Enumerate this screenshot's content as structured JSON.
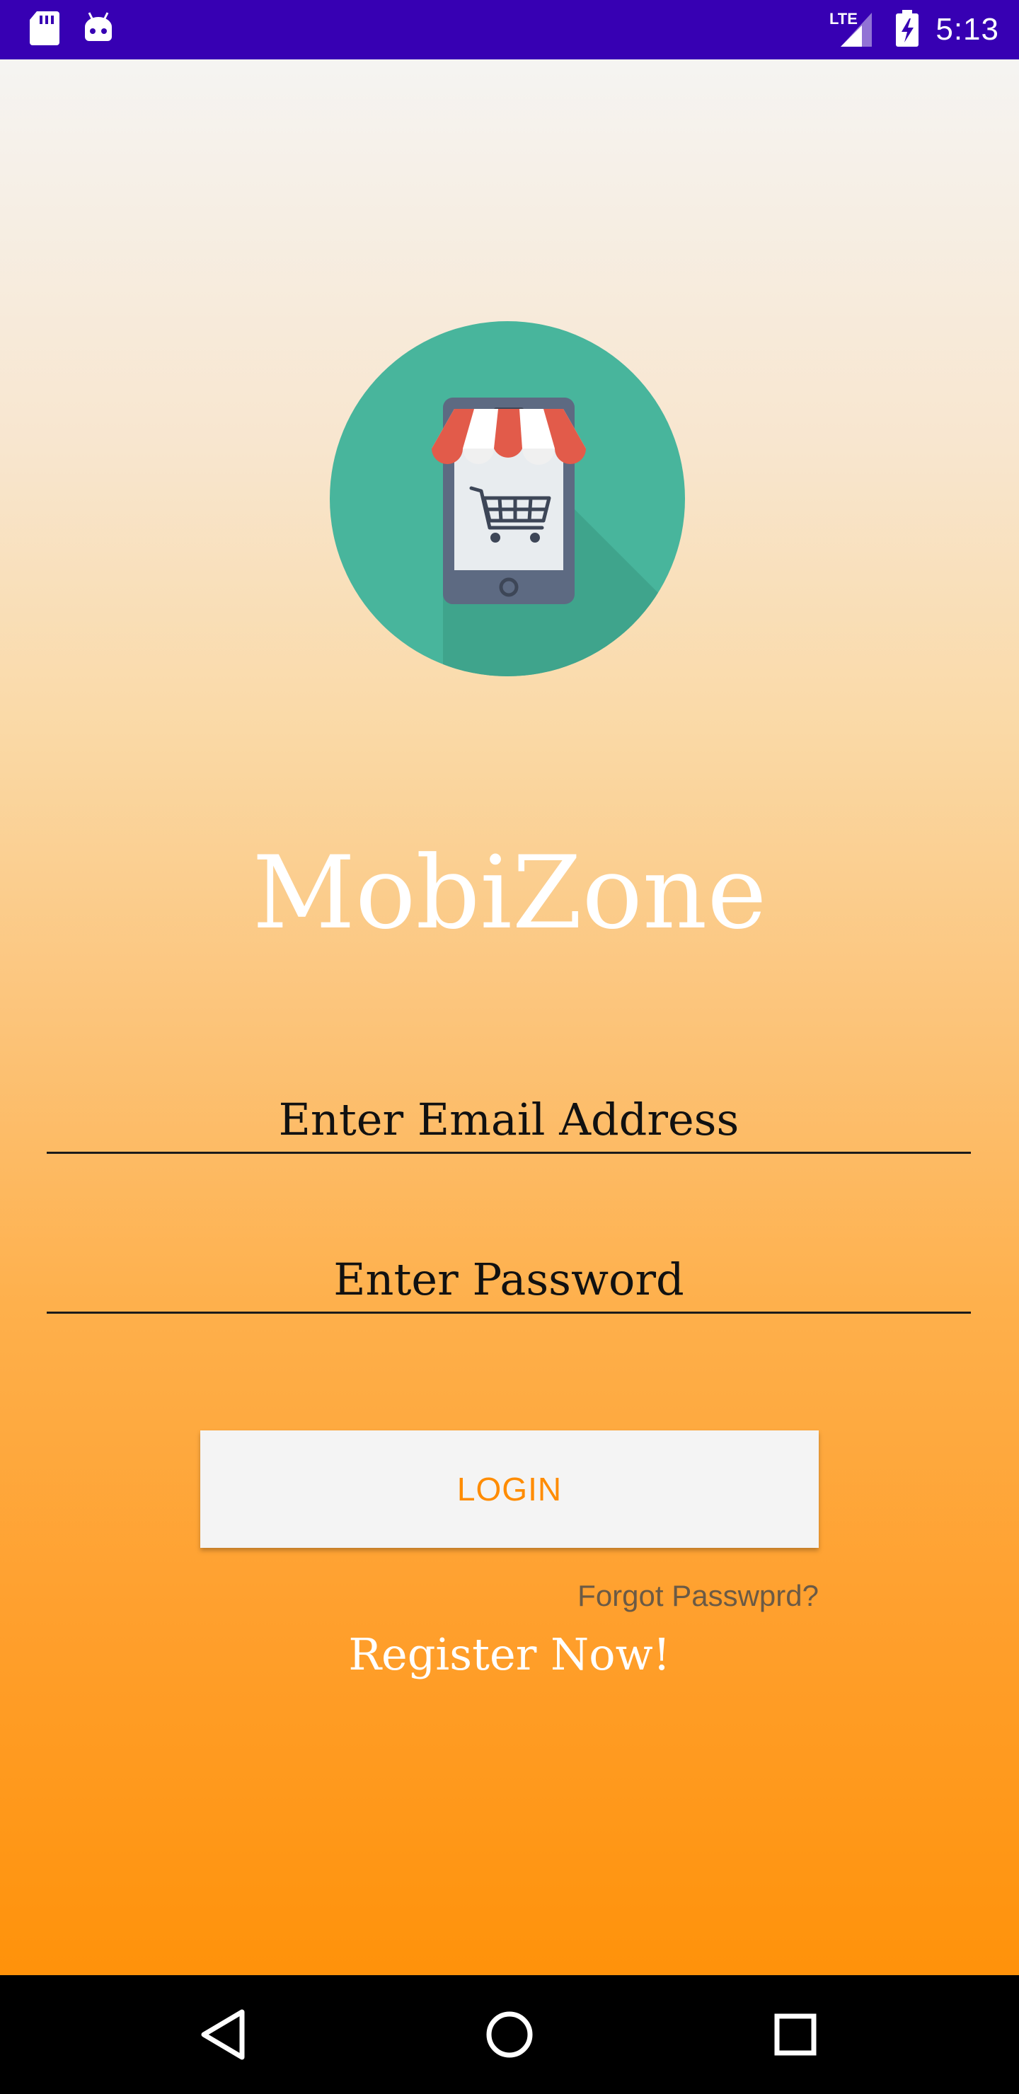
{
  "status_bar": {
    "time": "5:13",
    "network": "LTE",
    "icons": [
      "sd-card-icon",
      "android-icon",
      "signal-icon",
      "battery-charging-icon"
    ]
  },
  "app": {
    "title": "MobiZone",
    "logo_icon": "shopping-store-phone-icon",
    "email_placeholder": "Enter Email Address",
    "password_placeholder": "Enter Password",
    "login_label": "LOGIN",
    "forgot_label": "Forgot Passwprd?",
    "register_label": "Register Now!"
  },
  "nav_bar": {
    "icons": [
      "back-icon",
      "home-icon",
      "recents-icon"
    ]
  },
  "colors": {
    "status_bar": "#3700b3",
    "accent": "#ff8c00",
    "logo_circle": "#48b59c",
    "gradient_top": "#f5f4f2",
    "gradient_bottom": "#ff920a"
  }
}
